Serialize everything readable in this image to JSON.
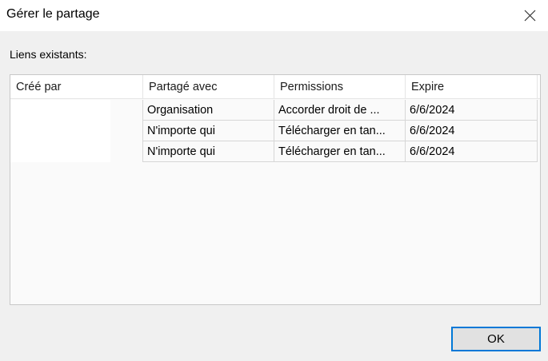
{
  "window": {
    "title": "Gérer le partage",
    "close_icon": "close-icon"
  },
  "section": {
    "label": "Liens existants:"
  },
  "table": {
    "columns": [
      "Créé par",
      "Partagé avec",
      "Permissions",
      "Expire"
    ],
    "rows": [
      {
        "created_by": "",
        "shared_with": "Organisation",
        "permissions": "Accorder droit de ...",
        "expires": "6/6/2024"
      },
      {
        "created_by": "",
        "shared_with": "N'importe qui",
        "permissions": "Télécharger en tan...",
        "expires": "6/6/2024"
      },
      {
        "created_by": "",
        "shared_with": "N'importe qui",
        "permissions": "Télécharger en tan...",
        "expires": "6/6/2024"
      }
    ]
  },
  "buttons": {
    "ok_label": "OK"
  },
  "colors": {
    "accent": "#0078d7",
    "background": "#f0f0f0"
  }
}
